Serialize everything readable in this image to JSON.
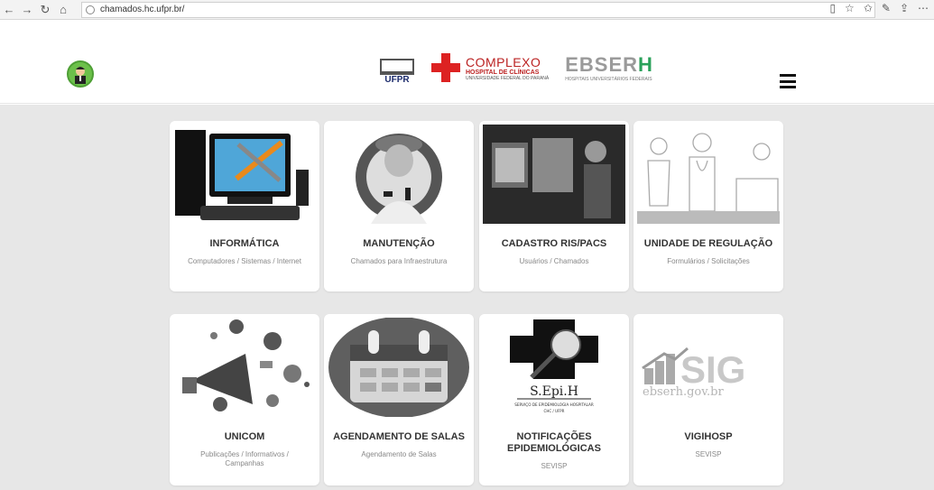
{
  "browser": {
    "url": "chamados.hc.ufpr.br/"
  },
  "header": {
    "logos": {
      "ufpr": "UFPR",
      "complexo_line1": "COMPLEXO",
      "complexo_line2": "HOSPITAL DE CLÍNICAS",
      "complexo_line3": "UNIVERSIDADE FEDERAL DO PARANÁ",
      "ebserh_prefix": "EBSER",
      "ebserh_suffix": "H",
      "ebserh_sub": "HOSPITAIS UNIVERSITÁRIOS FEDERAIS"
    }
  },
  "cards": [
    {
      "title": "INFORMÁTICA",
      "desc": "Computadores / Sistemas / Internet"
    },
    {
      "title": "MANUTENÇÃO",
      "desc": "Chamados para Infraestrutura"
    },
    {
      "title": "CADASTRO RIS/PACS",
      "desc": "Usuários / Chamados"
    },
    {
      "title": "UNIDADE DE REGULAÇÃO",
      "desc": "Formulários / Solicitações"
    },
    {
      "title": "UNICOM",
      "desc": "Publicações / Informativos / Campanhas"
    },
    {
      "title": "AGENDAMENTO DE SALAS",
      "desc": "Agendamento de Salas"
    },
    {
      "title": "NOTIFICAÇÕES EPIDEMIOLÓGICAS",
      "desc": "SEVISP"
    },
    {
      "title": "VIGIHOSP",
      "desc": "SEVISP"
    }
  ],
  "sepih": {
    "name": "S.Epi.H",
    "sub": "SERVIÇO DE EPIDEMIOLOGIA HOSPITALAR",
    "sub2": "CHC / UFPR"
  },
  "sig": {
    "text": "SIG",
    "domain": "ebserh.gov.br"
  }
}
